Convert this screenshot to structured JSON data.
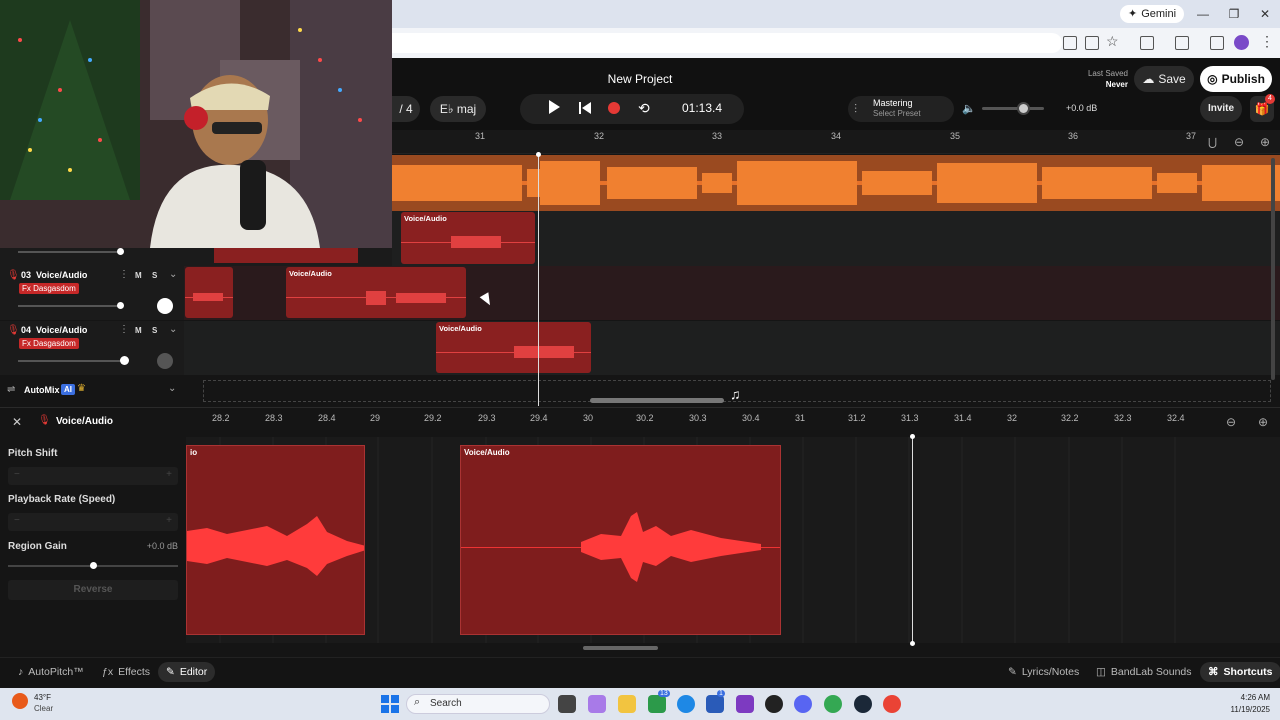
{
  "browser": {
    "gemini_label": "Gemini"
  },
  "header": {
    "project_title": "New Project",
    "last_saved_label": "Last Saved",
    "last_saved_value": "Never",
    "save_label": "Save",
    "publish_label": "Publish",
    "time_sig": "/ 4",
    "key": "E♭ maj",
    "time_display": "01:13.4",
    "mastering_label": "Mastering",
    "mastering_preset": "Select Preset",
    "volume_db": "+0.0 dB",
    "invite_label": "Invite",
    "gift_count": "4"
  },
  "ruler": {
    "bars": [
      "31",
      "32",
      "33",
      "34",
      "35",
      "36",
      "37"
    ]
  },
  "tracks": [
    {
      "number": "03",
      "name": "Voice/Audio",
      "fx": "Fx Dasgasdom",
      "mute": "M",
      "solo": "S",
      "clips": [
        "Voice/Audio"
      ]
    },
    {
      "number": "04",
      "name": "Voice/Audio",
      "fx": "Fx Dasgasdom",
      "mute": "M",
      "solo": "S",
      "clips": [
        "Voice/Audio"
      ]
    }
  ],
  "upper_clip_label": "Voice/Audio",
  "automix": {
    "label": "AutoMix",
    "ai_badge": "AI"
  },
  "editor": {
    "track_name": "Voice/Audio",
    "ticks": [
      "28.2",
      "28.3",
      "28.4",
      "29",
      "29.2",
      "29.3",
      "29.4",
      "30",
      "30.2",
      "30.3",
      "30.4",
      "31",
      "31.2",
      "31.3",
      "31.4",
      "32",
      "32.2",
      "32.3",
      "32.4"
    ],
    "pitch_shift_label": "Pitch Shift",
    "playback_rate_label": "Playback Rate (Speed)",
    "region_gain_label": "Region Gain",
    "region_gain_value": "+0.0 dB",
    "reverse_label": "Reverse",
    "clip_left_label": "io",
    "clip_right_label": "Voice/Audio",
    "stepper_minus": "−",
    "stepper_plus": "+"
  },
  "bottom_bar": {
    "autopitch": "AutoPitch™",
    "effects": "Effects",
    "editor": "Editor",
    "lyrics": "Lyrics/Notes",
    "sounds": "BandLab Sounds",
    "shortcuts": "Shortcuts"
  },
  "taskbar": {
    "weather_temp": "43°F",
    "weather_desc": "Clear",
    "search_label": "Search",
    "time": "4:26 AM",
    "date": "11/19/2025",
    "badge_teams": "13",
    "badge_store": "1"
  },
  "colors": {
    "master_wave": "#e8722a",
    "clip_red": "#8a2020",
    "publish_bg": "#ffffff"
  }
}
